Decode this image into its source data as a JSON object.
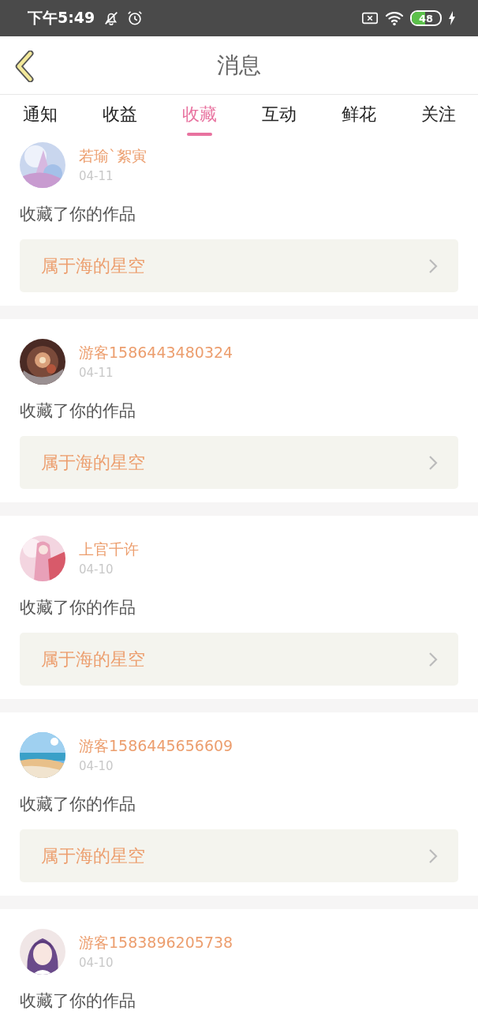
{
  "status_bar": {
    "time": "下午5:49",
    "battery": "48"
  },
  "header": {
    "title": "消息"
  },
  "tabs": [
    {
      "label": "通知",
      "selected": false
    },
    {
      "label": "收益",
      "selected": false
    },
    {
      "label": "收藏",
      "selected": true
    },
    {
      "label": "互动",
      "selected": false
    },
    {
      "label": "鲜花",
      "selected": false
    },
    {
      "label": "关注",
      "selected": false
    }
  ],
  "messages": [
    {
      "name": "若瑜`絮寅",
      "date": "04-11",
      "text": "收藏了你的作品",
      "work": "属于海的星空"
    },
    {
      "name": "游客1586443480324",
      "date": "04-11",
      "text": "收藏了你的作品",
      "work": "属于海的星空"
    },
    {
      "name": "上官千许",
      "date": "04-10",
      "text": "收藏了你的作品",
      "work": "属于海的星空"
    },
    {
      "name": "游客1586445656609",
      "date": "04-10",
      "text": "收藏了你的作品",
      "work": "属于海的星空"
    },
    {
      "name": "游客1583896205738",
      "date": "04-10",
      "text": "收藏了你的作品"
    }
  ]
}
